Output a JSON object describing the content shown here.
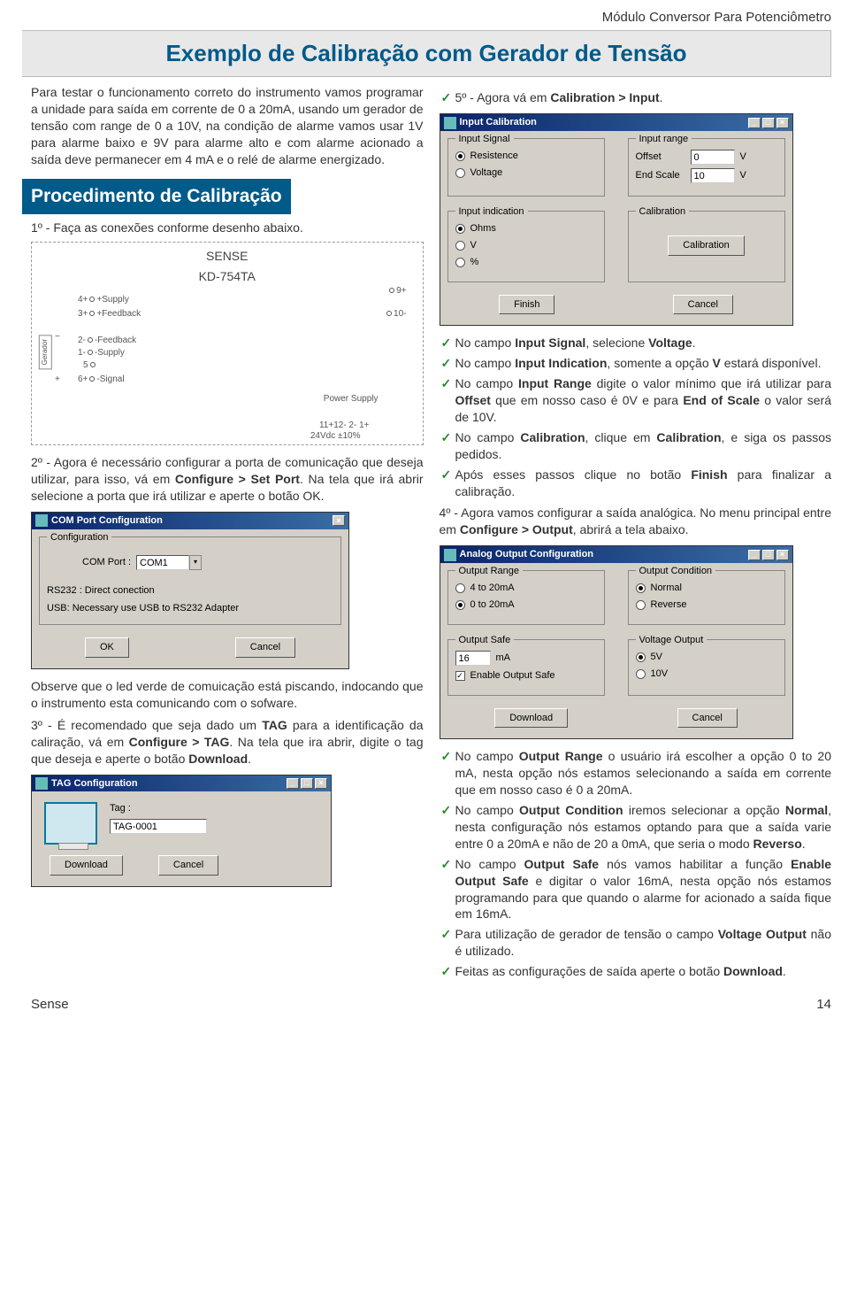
{
  "doc": {
    "header": "Módulo Conversor Para Potenciômetro",
    "title": "Exemplo de Calibração com Gerador de Tensão",
    "footer_brand": "Sense",
    "footer_page": "14"
  },
  "left": {
    "intro": "Para testar o funcionamento correto do instrumento vamos programar a unidade para saída em corrente de 0 a 20mA, usando um gerador de tensão com range de 0 a 10V, na condição de alarme vamos usar 1V para alarme baixo e 9V para alarme alto e com alarme acionado a saída deve permanecer em 4 mA e o relé de alarme energizado.",
    "sub_title": "Procedimento de Calibração",
    "step1": "1º - Faça as conexões conforme desenho abaixo.",
    "diagram": {
      "device_l1": "SENSE",
      "device_l2": "KD-754TA",
      "pins_left": [
        "4+",
        "3+",
        "2-",
        "1-",
        "5",
        "6+"
      ],
      "labels_left": [
        "+Supply",
        "+Feedback",
        "-Feedback",
        "-Supply",
        "",
        "-Signal"
      ],
      "pins_right": [
        "9+",
        "10-"
      ],
      "power": "Power Supply",
      "power_pins": "11+12-  2-  1+",
      "power_spec": "24Vdc ±10%",
      "gen_label": "Gerador",
      "gen_plus": "+",
      "gen_minus": "−"
    },
    "step2a": "2º - Agora é necessário configurar a porta de comunicação que deseja utilizar, para isso, vá em ",
    "step2b": "Configure > Set Port",
    "step2c": ". Na tela que irá abrir selecione a porta que irá utilizar e aperte o botão OK.",
    "com_dialog": {
      "title": "COM Port Configuration",
      "legend": "Configuration",
      "label": "COM Port :",
      "value": "COM1",
      "hint1": "RS232 : Direct conection",
      "hint2": "USB: Necessary use USB to RS232 Adapter",
      "ok": "OK",
      "cancel": "Cancel"
    },
    "observe": "Observe que o led verde de comuicação está piscando, indocando que o instrumento esta comunicando com o sofware.",
    "step3a": "3º - É recomendado que seja dado um ",
    "step3b": "TAG",
    "step3c": " para a identificação da caliração, vá em ",
    "step3d": "Configure > TAG",
    "step3e": ". Na tela que ira abrir, digite o tag que deseja e aperte o botão ",
    "step3f": "Download",
    "step3g": ".",
    "tag_dialog": {
      "title": "TAG Configuration",
      "label": "Tag :",
      "value": "TAG-0001",
      "download": "Download",
      "cancel": "Cancel"
    }
  },
  "right": {
    "step5a": "5º - Agora vá em ",
    "step5b": "Calibration > Input",
    "step5c": ".",
    "input_dialog": {
      "title": "Input Calibration",
      "sig_legend": "Input Signal",
      "sig_res": "Resistence",
      "sig_vol": "Voltage",
      "rng_legend": "Input range",
      "offset_label": "Offset",
      "offset_val": "0",
      "offset_unit": "V",
      "end_label": "End Scale",
      "end_val": "10",
      "end_unit": "V",
      "ind_legend": "Input indication",
      "ind_ohms": "Ohms",
      "ind_v": "V",
      "ind_pct": "%",
      "cal_legend": "Calibration",
      "cal_btn": "Calibration",
      "finish": "Finish",
      "cancel": "Cancel"
    },
    "bullets1": [
      "No campo <b>Input Signal</b>, selecione <b>Voltage</b>.",
      "No campo <b>Input Indication</b>, somente a opção <b>V</b> estará disponível.",
      "No campo <b>Input Range</b> digite o valor mínimo que irá utilizar para <b>Offset</b> que em nosso caso é 0V e para <b>End of Scale</b> o valor será de 10V.",
      "No campo <b>Calibration</b>, clique em <b>Calibration</b>, e siga os passos pedidos.",
      "Após esses passos clique no botão <b>Finish</b> para finalizar a calibração."
    ],
    "step4a": "4º - Agora vamos configurar a saída analógica. No menu principal entre em ",
    "step4b": "Configure > Output",
    "step4c": ", abrirá a tela abaixo.",
    "output_dialog": {
      "title": "Analog Output Configuration",
      "rng_legend": "Output Range",
      "rng_4_20": "4 to 20mA",
      "rng_0_20": "0 to 20mA",
      "cond_legend": "Output Condition",
      "cond_norm": "Normal",
      "cond_rev": "Reverse",
      "safe_legend": "Output Safe",
      "safe_val": "16",
      "safe_unit": "mA",
      "safe_enable": "Enable Output Safe",
      "vout_legend": "Voltage Output",
      "vout_5": "5V",
      "vout_10": "10V",
      "download": "Download",
      "cancel": "Cancel"
    },
    "bullets2": [
      "No campo <b>Output Range</b> o usuário irá escolher a opção 0 to 20 mA, nesta opção nós estamos selecionando a saída em corrente que em nosso caso é  0 a 20mA.",
      "No campo <b>Output Condition</b> iremos selecionar a opção <b>Normal</b>, nesta configuração nós estamos optando para que a saída varie entre 0 a 20mA e não de 20 a 0mA, que seria o modo <b>Reverso</b>.",
      "No campo <b>Output Safe</b> nós vamos habilitar a função <b>Enable Output Safe</b> e digitar o valor 16mA, nesta opção nós estamos programando para que quando o alarme for acionado a saída fique em 16mA.",
      "Para utilização de gerador de tensão o campo <b>Voltage Output</b> não é utilizado.",
      "Feitas as configurações de saída aperte o botão <b>Download</b>."
    ]
  }
}
